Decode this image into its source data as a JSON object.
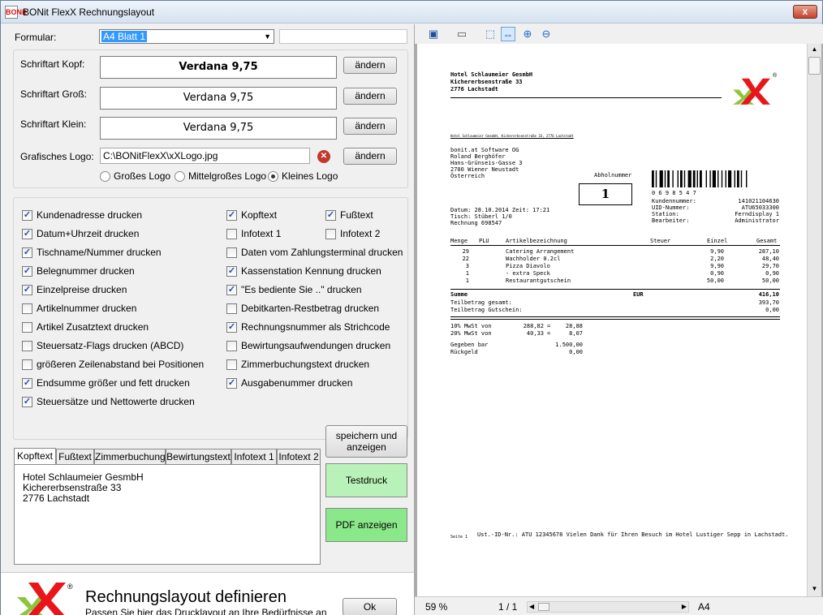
{
  "window": {
    "title": "BONit FlexX Rechnungslayout",
    "icon_text": "BONit",
    "close_glyph": "x"
  },
  "formular": {
    "label": "Formular:",
    "value": "A4  Blatt 1",
    "extra_value": ""
  },
  "fonts": {
    "kopf": {
      "label": "Schriftart Kopf:",
      "value": "Verdana 9,75"
    },
    "gross": {
      "label": "Schriftart Groß:",
      "value": "Verdana 9,75"
    },
    "klein": {
      "label": "Schriftart Klein:",
      "value": "Verdana 9,75"
    },
    "change_label": "ändern"
  },
  "logo": {
    "label": "Grafisches Logo:",
    "path": "C:\\BONitFlexX\\xXLogo.jpg",
    "change_label": "ändern",
    "sizes": [
      {
        "label": "Großes Logo",
        "selected": false
      },
      {
        "label": "Mittelgroßes Logo",
        "selected": false
      },
      {
        "label": "Kleines Logo",
        "selected": true
      }
    ]
  },
  "options_col1": [
    {
      "label": "Kundenadresse drucken",
      "checked": true
    },
    {
      "label": "Datum+Uhrzeit drucken",
      "checked": true
    },
    {
      "label": "Tischname/Nummer drucken",
      "checked": true
    },
    {
      "label": "Belegnummer drucken",
      "checked": true
    },
    {
      "label": "Einzelpreise drucken",
      "checked": true
    },
    {
      "label": "Artikelnummer drucken",
      "checked": false
    },
    {
      "label": "Artikel Zusatztext drucken",
      "checked": false
    },
    {
      "label": "Steuersatz-Flags drucken (ABCD)",
      "checked": false
    },
    {
      "label": "größeren Zeilenabstand bei Positionen",
      "checked": false
    },
    {
      "label": "Endsumme größer und fett drucken",
      "checked": true
    },
    {
      "label": "Steuersätze und Nettowerte drucken",
      "checked": true
    }
  ],
  "options_col2": [
    {
      "label": "Kopftext",
      "checked": true
    },
    {
      "label": "Infotext 1",
      "checked": false
    },
    {
      "label": "Daten vom Zahlungsterminal drucken",
      "checked": false
    },
    {
      "label": "Kassenstation Kennung drucken",
      "checked": true
    },
    {
      "label": "\"Es bediente Sie ..\" drucken",
      "checked": true
    },
    {
      "label": "Debitkarten-Restbetrag drucken",
      "checked": false
    },
    {
      "label": "Rechnungsnummer als Strichcode",
      "checked": true
    },
    {
      "label": "Bewirtungsaufwendungen drucken",
      "checked": false
    },
    {
      "label": "Zimmerbuchungstext drucken",
      "checked": false
    },
    {
      "label": "Ausgabenummer drucken",
      "checked": true
    }
  ],
  "options_col3": [
    {
      "label": "Fußtext",
      "checked": true
    },
    {
      "label": "Infotext 2",
      "checked": false
    }
  ],
  "tabs": [
    "Kopftext",
    "Fußtext",
    "Zimmerbuchung",
    "Bewirtungstext",
    "Infotext 1",
    "Infotext 2"
  ],
  "kopftext_lines": [
    "Hotel Schlaumeier GesmbH",
    "Kichererbsenstraße 33",
    "2776 Lachstadt"
  ],
  "buttons": {
    "save": "speichern und\nanzeigen",
    "testdruck": "Testdruck",
    "pdf": "PDF anzeigen",
    "ok": "Ok"
  },
  "footer": {
    "title": "Rechnungslayout definieren",
    "subtitle": "Passen Sie hier das Drucklayout an Ihre Bedürfnisse an",
    "registered": "®"
  },
  "status": {
    "zoom": "59 %",
    "page": "1 / 1",
    "format": "A4"
  },
  "receipt": {
    "sender": [
      "Hotel  Schlaumeier  GesmbH",
      "Kichererbsenstraße  33",
      "2776  Lachstadt"
    ],
    "sender_small": "Hotel  Schlaumeier  GesmbH,  Kichererbsenstraße  33,  2776  Lachstadt",
    "customer": [
      "bonit.at Software OG",
      "Roland  Berghöfer",
      "Hans-Grünseis-Gasse  3",
      "2700  Wiener  Neustadt",
      "Österreich"
    ],
    "abholnummer_label": "Abholnummer",
    "abholnummer": "1",
    "barcode_digits": "0   6   9   8   5   4   7",
    "info_labels": [
      "Kundennummer:",
      "UID-Nummer:",
      "Station:",
      "Bearbeiter:"
    ],
    "info_values": [
      "14102110463​0",
      "ATU65033300",
      "Ferndisplay  1",
      "Administrator"
    ],
    "date_line": "Datum:  28.10.2014    Zeit:  17:21",
    "tisch_line": "Tisch:  Stüberl  1/0",
    "rechnung_line": "Rechnung  698547",
    "columns": [
      "Menge",
      "PLU",
      "Artikelbezeichnung",
      "Steuer",
      "Einzel",
      "Gesamt"
    ],
    "items": [
      {
        "menge": "29",
        "bez": "Catering  Arrangement",
        "einzel": "9,90",
        "gesamt": "287,10"
      },
      {
        "menge": "22",
        "bez": "Wachholder  0.2cl",
        "einzel": "2,20",
        "gesamt": "48,40"
      },
      {
        "menge": "3",
        "bez": "Pizza  Diavolo",
        "einzel": "9,90",
        "gesamt": "29,70"
      },
      {
        "menge": "1",
        "bez": "  - extra  Speck",
        "einzel": "0,90",
        "gesamt": "0,90"
      },
      {
        "menge": "1",
        "bez": "Restaurantgutschein",
        "einzel": "50,00",
        "gesamt": "50,00"
      }
    ],
    "summe_label": "Summe",
    "currency": "EUR",
    "summe": "416,10",
    "teil_labels": [
      "Teilbetrag  gesamt:",
      "Teilbetrag  Gutschein:"
    ],
    "teil_values": [
      "393,70",
      "0,00"
    ],
    "tax_lines": [
      {
        "label": "10%  MwSt  von",
        "base": "288,82",
        "sep": "=",
        "tax": "28,88"
      },
      {
        "label": "20%  MwSt  von",
        "base": "40,33",
        "sep": "=",
        "tax": "8,07"
      }
    ],
    "pay_labels": [
      "Gegeben  bar",
      "Rückgeld"
    ],
    "pay_values": [
      "1.500,00",
      "0,00"
    ],
    "seite": "Seite  1",
    "footer_text": "Ust.-ID-Nr.:  ATU  12345678  Vielen  Dank  für  Ihren  Besuch  im  Hotel  Lustiger  Sepp  in  Lachstadt."
  },
  "colors": {
    "green_button": "#b9f2b9",
    "green_button_dark": "#8ae88a",
    "logo_red": "#e8161b",
    "logo_green": "#8cc63e"
  }
}
